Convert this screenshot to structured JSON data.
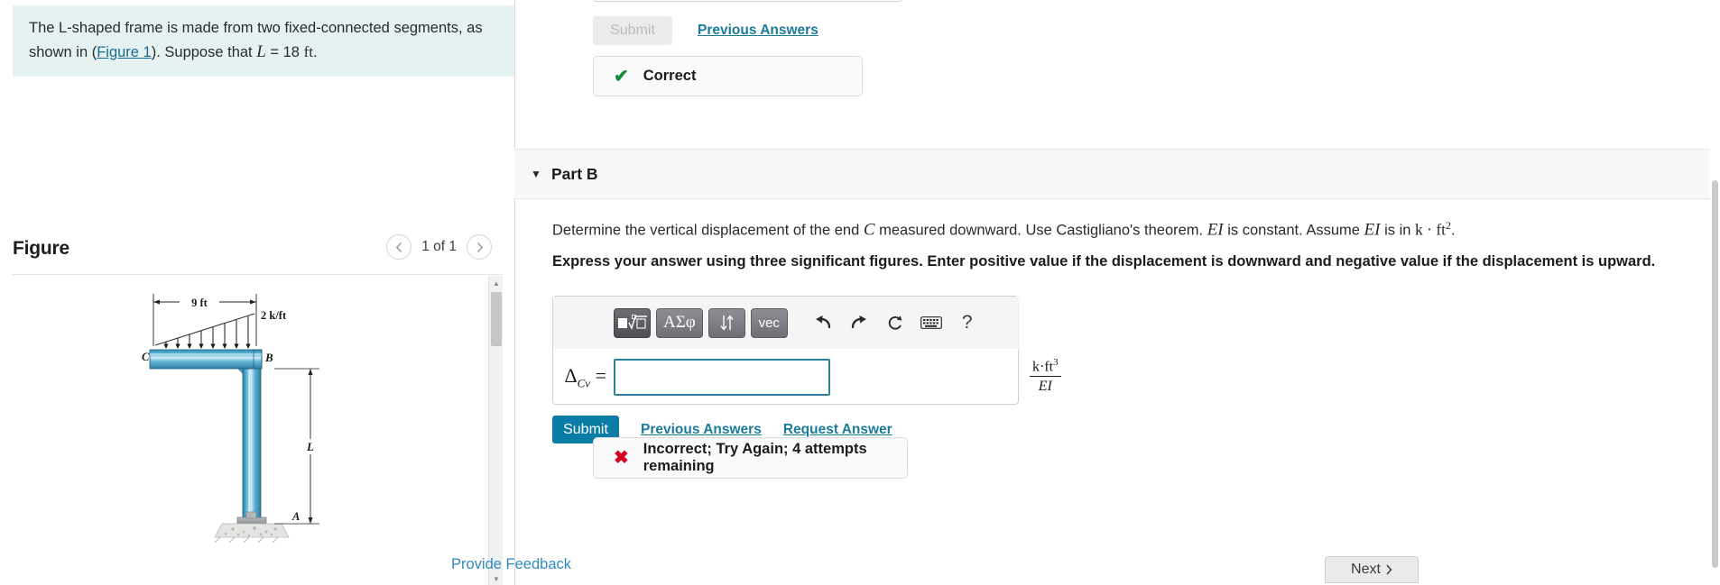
{
  "left": {
    "problem": {
      "text_before_var": "The L-shaped frame is made from two fixed-connected segments, as shown in (",
      "figure_link": "Figure 1",
      "text_after_link": "). Suppose that ",
      "length_symbol": "L",
      "equals": " = 18 ",
      "length_unit": "ft",
      "period": "."
    },
    "figure": {
      "title": "Figure",
      "counter": "1 of 1",
      "prev_icon": "chevron-left-icon",
      "next_icon": "chevron-right-icon",
      "diagram": {
        "span_label": "9 ft",
        "load_label": "2 k/ft",
        "point_c": "C",
        "point_b": "B",
        "point_a": "A",
        "column_label": "L",
        "beam_color": "#3c9bc4",
        "beam_highlight": "#bfe4f2"
      }
    }
  },
  "right": {
    "part_a": {
      "submit_label": "Submit",
      "previous_answers_label": "Previous Answers",
      "feedback_icon": "check-icon",
      "feedback_text": "Correct",
      "feedback_color": "#128a3a"
    },
    "part_b": {
      "caret_icon": "caret-down-icon",
      "label": "Part B",
      "question": {
        "t1": "Determine the vertical displacement of the end ",
        "var_c": "C",
        "t2": " measured downward. Use Castigliano's theorem. ",
        "var_ei1": "EI",
        "t3": " is constant. Assume ",
        "var_ei2": "EI",
        "t4": " is in ",
        "unit": "k · ft",
        "unit_exp": "2",
        "t5": "."
      },
      "instruction": "Express your answer using three significant figures. Enter positive value if the displacement is downward and negative value if the displacement is upward.",
      "toolbar": {
        "template_button": "⬜√",
        "greek_button": "ΑΣφ",
        "script_button": "↓↑",
        "vector_button": "vec",
        "undo_icon": "undo-arrow-icon",
        "redo_icon": "redo-arrow-icon",
        "reset_icon": "refresh-icon",
        "keyboard_icon": "keyboard-icon",
        "help_label": "?"
      },
      "answer": {
        "label_delta": "Δ",
        "label_sub": "Cv",
        "label_equals": "=",
        "value": "",
        "placeholder": ""
      },
      "units": {
        "numerator": "k·ft",
        "numerator_exp": "3",
        "denominator": "EI"
      },
      "submit_label": "Submit",
      "previous_answers_label": "Previous Answers",
      "request_answer_label": "Request Answer",
      "feedback_icon": "cross-icon",
      "feedback_text": "Incorrect; Try Again; 4 attempts remaining",
      "feedback_color": "#d6001c"
    },
    "footer": {
      "provide_feedback_label": "Provide Feedback",
      "next_label": "Next",
      "next_icon": "chevron-right-icon"
    }
  },
  "colors": {
    "accent_blue": "#0a7ca5",
    "link_blue": "#1a7b9b",
    "statement_bg": "#e6f2f2",
    "correct_green": "#128a3a",
    "incorrect_red": "#d6001c"
  }
}
